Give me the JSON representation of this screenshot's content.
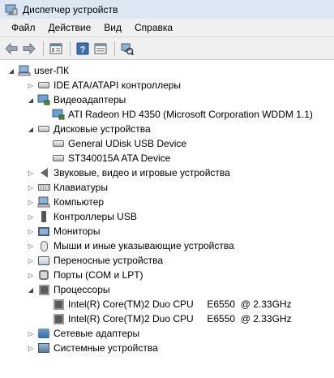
{
  "window": {
    "title": "Диспетчер устройств",
    "title_icon": "device-manager-icon"
  },
  "menu": [
    "Файл",
    "Действие",
    "Вид",
    "Справка"
  ],
  "toolbar": {
    "buttons": [
      "back-arrow-icon",
      "forward-arrow-icon",
      "properties-icon",
      "help-icon",
      "view-icon",
      "scan-hardware-icon"
    ]
  },
  "tree": {
    "root": "user-ПК",
    "items": [
      {
        "label": "IDE ATA/ATAPI контроллеры",
        "icon": "ide-controller-icon",
        "expanded": false
      },
      {
        "label": "Видеоадаптеры",
        "icon": "display-adapter-icon",
        "expanded": true
      },
      {
        "label": "ATI Radeon HD 4350 (Microsoft Corporation WDDM 1.1)",
        "icon": "display-adapter-icon",
        "child": true
      },
      {
        "label": "Дисковые устройства",
        "icon": "disk-drive-icon",
        "expanded": true
      },
      {
        "label": "General UDisk USB Device",
        "icon": "disk-drive-icon",
        "child": true
      },
      {
        "label": "ST340015A ATA Device",
        "icon": "disk-drive-icon",
        "child": true
      },
      {
        "label": "Звуковые, видео и игровые устройства",
        "icon": "speaker-icon",
        "expanded": false
      },
      {
        "label": "Клавиатуры",
        "icon": "keyboard-icon",
        "expanded": false
      },
      {
        "label": "Компьютер",
        "icon": "computer-icon",
        "expanded": false
      },
      {
        "label": "Контроллеры USB",
        "icon": "usb-icon",
        "expanded": false
      },
      {
        "label": "Мониторы",
        "icon": "monitor-icon",
        "expanded": false
      },
      {
        "label": "Мыши и иные указывающие устройства",
        "icon": "mouse-icon",
        "expanded": false
      },
      {
        "label": "Переносные устройства",
        "icon": "portable-device-icon",
        "expanded": false
      },
      {
        "label": "Порты (COM и LPT)",
        "icon": "port-icon",
        "expanded": false
      },
      {
        "label": "Процессоры",
        "icon": "cpu-icon",
        "expanded": true
      },
      {
        "label": "Intel(R) Core(TM)2 Duo CPU     E6550  @ 2.33GHz",
        "icon": "cpu-icon",
        "child": true
      },
      {
        "label": "Intel(R) Core(TM)2 Duo CPU     E6550  @ 2.33GHz",
        "icon": "cpu-icon",
        "child": true
      },
      {
        "label": "Сетевые адаптеры",
        "icon": "network-adapter-icon",
        "expanded": false
      },
      {
        "label": "Системные устройства",
        "icon": "system-device-icon",
        "expanded": false
      }
    ]
  }
}
